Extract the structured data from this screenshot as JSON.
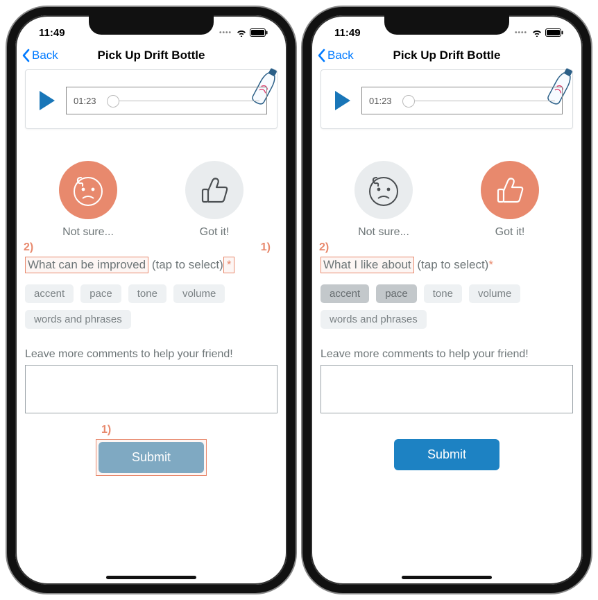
{
  "status": {
    "time": "11:49"
  },
  "nav": {
    "back": "Back",
    "title": "Pick Up Drift Bottle"
  },
  "audio": {
    "time": "01:23"
  },
  "ratings": {
    "not_sure": "Not sure...",
    "got_it": "Got it!"
  },
  "left": {
    "prompt_main": "What can be improved",
    "prompt_tail": "(tap to select)",
    "anno1": "1)",
    "anno2": "2)",
    "submit_anno": "1)"
  },
  "right": {
    "prompt_main": "What I like about",
    "prompt_tail": "(tap to select)",
    "anno2": "2)"
  },
  "tags": {
    "accent": "accent",
    "pace": "pace",
    "tone": "tone",
    "volume": "volume",
    "words": "words and phrases"
  },
  "comments_label": "Leave more comments to help your friend!",
  "submit_label": "Submit",
  "asterisk": "*"
}
